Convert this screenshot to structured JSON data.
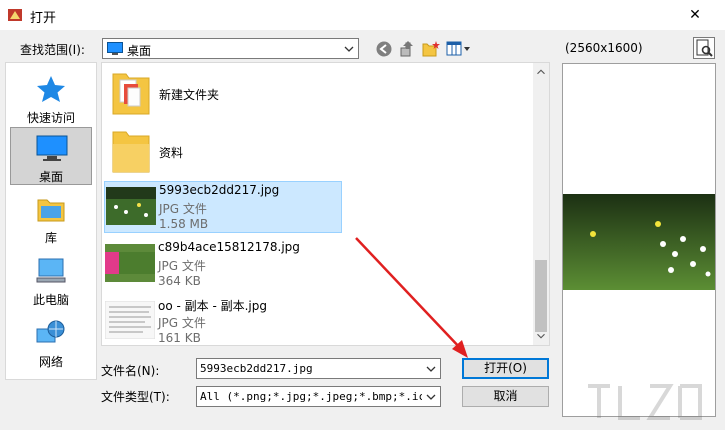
{
  "window": {
    "title": "打开",
    "close_glyph": "✕"
  },
  "toolbar": {
    "lookin_label": "查找范围(I):",
    "lookin_value": "桌面",
    "preview_size": "(2560x1600)"
  },
  "places": [
    {
      "label": "快速访问",
      "icon": "quick-access-star-icon",
      "selected": false
    },
    {
      "label": "桌面",
      "icon": "desktop-icon",
      "selected": true
    },
    {
      "label": "库",
      "icon": "library-icon",
      "selected": false
    },
    {
      "label": "此电脑",
      "icon": "computer-icon",
      "selected": false
    },
    {
      "label": "网络",
      "icon": "network-icon",
      "selected": false
    }
  ],
  "files": [
    {
      "kind": "folder",
      "name": "新建文件夹"
    },
    {
      "kind": "folder",
      "name": "资料"
    },
    {
      "kind": "file",
      "name": "5993ecb2dd217.jpg",
      "type": "JPG 文件",
      "size": "1.58 MB",
      "selected": true
    },
    {
      "kind": "file",
      "name": "c89b4ace15812178.jpg",
      "type": "JPG 文件",
      "size": "364 KB",
      "selected": false
    },
    {
      "kind": "file",
      "name": "oo - 副本 - 副本.jpg",
      "type": "JPG 文件",
      "size": "161 KB",
      "selected": false
    }
  ],
  "bottom": {
    "filename_label": "文件名(N):",
    "filename_value": "5993ecb2dd217.jpg",
    "filetype_label": "文件类型(T):",
    "filetype_value": "All (*.png;*.jpg;*.jpeg;*.bmp;*.ico;*",
    "open_label": "打开(O)",
    "cancel_label": "取消"
  },
  "colors": {
    "selection": "#cce8ff",
    "accent": "#0078d7",
    "annotation": "#e02020"
  }
}
